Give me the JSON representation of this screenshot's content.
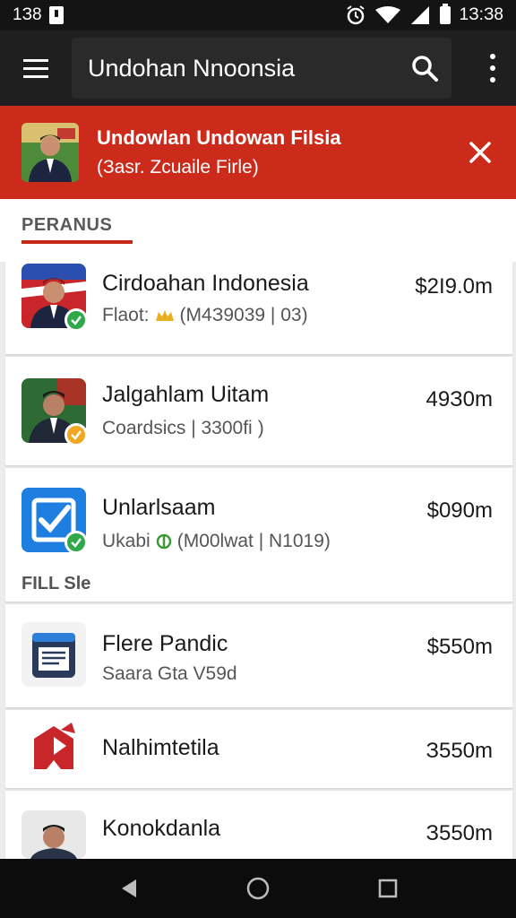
{
  "status_bar": {
    "left_time": "1З8",
    "right_time": "1З:З8"
  },
  "app_bar": {
    "title": "Undohan Nnoonsia"
  },
  "banner": {
    "title": "Undowlan Undowan Filsia",
    "subtitle": "(Заsr. Zcuaile Firle)",
    "color": "#cc2a1a"
  },
  "sections": [
    {
      "label": "PERANUS"
    },
    {
      "label": "FILL Sle"
    }
  ],
  "items": [
    {
      "name": "Cirdoahan Indonesia",
      "meta_prefix": "Flaot:",
      "meta_icon": "coin-icon",
      "meta_suffix": "(M4З9039 | 03)",
      "value": "$2І9.0m",
      "badge": "green-check"
    },
    {
      "name": "Jalgahlam Uitam",
      "meta_prefix": "Coardsics | 3300fi",
      "meta_icon": "",
      "meta_suffix": ")",
      "value": "49З0m",
      "badge": "yellow-check"
    },
    {
      "name": "Unlarlsaam",
      "meta_prefix": "Ukabi",
      "meta_icon": "leaf-icon",
      "meta_suffix": "(M00lwat | N1019)",
      "value": "$090m",
      "badge": "green-check"
    },
    {
      "name": "Flere Pandic",
      "meta_prefix": "Saara Gta V59d",
      "meta_icon": "",
      "meta_suffix": "",
      "value": "$550m",
      "badge": ""
    },
    {
      "name": "Nalhimtetila",
      "meta_prefix": "",
      "meta_icon": "",
      "meta_suffix": "",
      "value": "З550m",
      "badge": ""
    },
    {
      "name": "Konokdanla",
      "meta_prefix": "",
      "meta_icon": "",
      "meta_suffix": "",
      "value": "З550m",
      "badge": ""
    }
  ],
  "colors": {
    "accent": "#c62818",
    "check_green": "#2fa84a",
    "check_yellow": "#f0a820",
    "app_blue": "#1e7fe0"
  }
}
